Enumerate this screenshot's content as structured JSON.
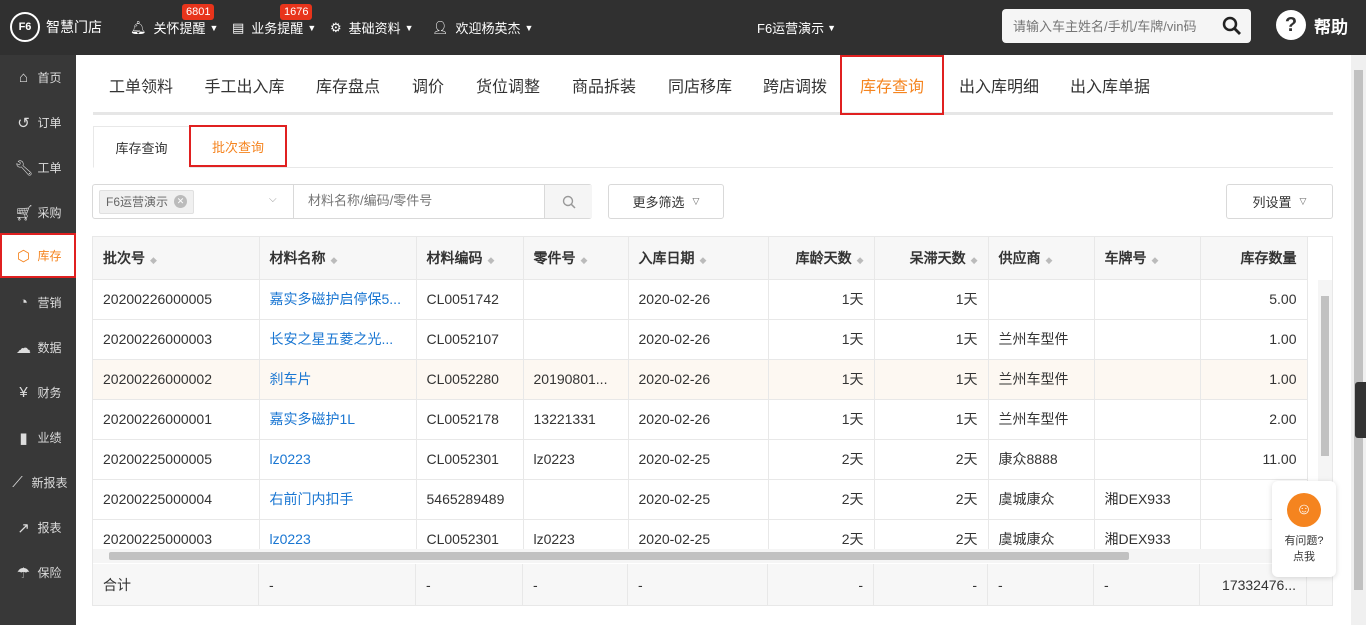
{
  "header": {
    "logo_mark": "F6",
    "logo_text": "智慧门店",
    "nav": [
      {
        "label": "关怀提醒",
        "badge": "6801"
      },
      {
        "label": "业务提醒",
        "badge": "1676"
      },
      {
        "label": "基础资料"
      },
      {
        "label": "欢迎杨英杰"
      }
    ],
    "store_title": "F6运营演示",
    "search_placeholder": "请输入车主姓名/手机/车牌/vin码",
    "help_label": "帮助"
  },
  "sidebar": {
    "items": [
      {
        "label": "首页",
        "icon": "home-icon"
      },
      {
        "label": "订单",
        "icon": "history-icon"
      },
      {
        "label": "工单",
        "icon": "wrench-icon"
      },
      {
        "label": "采购",
        "icon": "cart-icon"
      },
      {
        "label": "库存",
        "icon": "box-icon",
        "active": true
      },
      {
        "label": "营销",
        "icon": "pie-icon"
      },
      {
        "label": "数据",
        "icon": "cloud-icon"
      },
      {
        "label": "财务",
        "icon": "yen-icon"
      },
      {
        "label": "业绩",
        "icon": "bar-chart-icon"
      },
      {
        "label": "新报表",
        "icon": "line-chart-icon"
      },
      {
        "label": "报表",
        "icon": "trend-icon"
      },
      {
        "label": "保险",
        "icon": "umbrella-icon"
      }
    ]
  },
  "tabs": [
    "工单领料",
    "手工出入库",
    "库存盘点",
    "调价",
    "货位调整",
    "商品拆装",
    "同店移库",
    "跨店调拨",
    "库存查询",
    "出入库明细",
    "出入库单据"
  ],
  "active_tab": "库存查询",
  "subtabs": [
    "库存查询",
    "批次查询"
  ],
  "active_subtab": "批次查询",
  "filters": {
    "store_chip": "F6运营演示",
    "keyword_placeholder": "材料名称/编码/零件号",
    "more_filters": "更多筛选",
    "column_settings": "列设置"
  },
  "table": {
    "columns": [
      "批次号",
      "材料名称",
      "材料编码",
      "零件号",
      "入库日期",
      "库龄天数",
      "呆滞天数",
      "供应商",
      "车牌号",
      "库存数量"
    ],
    "rows": [
      [
        "20200226000005",
        "嘉实多磁护启停保5...",
        "CL0051742",
        "",
        "2020-02-26",
        "1天",
        "1天",
        "",
        "",
        "5.00"
      ],
      [
        "20200226000003",
        "长安之星五菱之光...",
        "CL0052107",
        "",
        "2020-02-26",
        "1天",
        "1天",
        "兰州车型件",
        "",
        "1.00"
      ],
      [
        "20200226000002",
        "刹车片",
        "CL0052280",
        "20190801...",
        "2020-02-26",
        "1天",
        "1天",
        "兰州车型件",
        "",
        "1.00"
      ],
      [
        "20200226000001",
        "嘉实多磁护1L",
        "CL0052178",
        "13221331",
        "2020-02-26",
        "1天",
        "1天",
        "兰州车型件",
        "",
        "2.00"
      ],
      [
        "20200225000005",
        "lz0223",
        "CL0052301",
        "lz0223",
        "2020-02-25",
        "2天",
        "2天",
        "康众8888",
        "",
        "11.00"
      ],
      [
        "20200225000004",
        "右前门内扣手",
        "5465289489",
        "",
        "2020-02-25",
        "2天",
        "2天",
        "虞城康众",
        "湘DEX933",
        "1"
      ],
      [
        "20200225000003",
        "lz0223",
        "CL0052301",
        "lz0223",
        "2020-02-25",
        "2天",
        "2天",
        "虞城康众",
        "湘DEX933",
        "1"
      ]
    ],
    "summary": [
      "合计",
      "-",
      "-",
      "-",
      "-",
      "-",
      "-",
      "-",
      "-",
      "17332476..."
    ]
  },
  "help_widget": {
    "line1": "有问题?",
    "line2": "点我"
  }
}
